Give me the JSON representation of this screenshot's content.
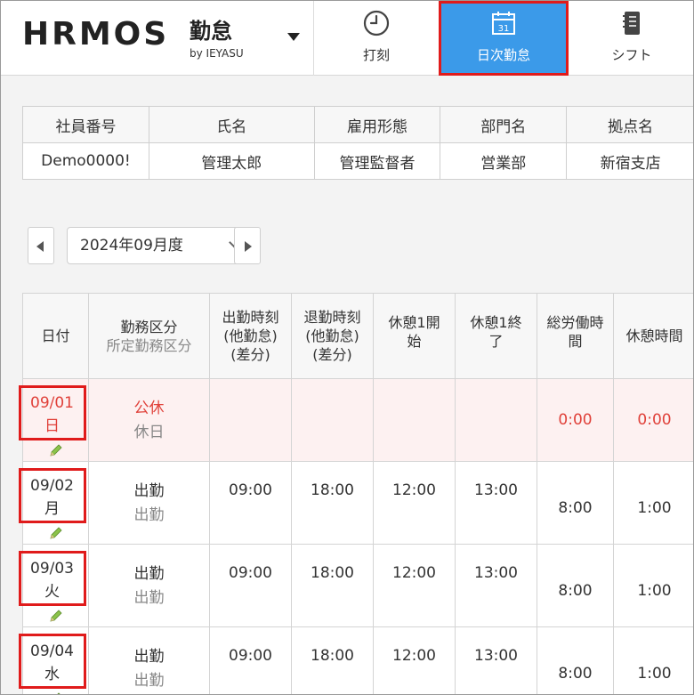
{
  "header": {
    "logo_text": "HRMOS",
    "product": "勤怠",
    "sub": "by IEYASU",
    "nav": [
      {
        "label": "打刻",
        "icon": "clock-icon"
      },
      {
        "label": "日次勤怠",
        "icon": "calendar-icon",
        "badge": "31",
        "active": true
      },
      {
        "label": "シフト",
        "icon": "notebook-icon"
      }
    ],
    "accent_color": "#3b9ae9",
    "highlight_color": "#e01b1b"
  },
  "employee": {
    "headers": [
      "社員番号",
      "氏名",
      "雇用形態",
      "部門名",
      "拠点名"
    ],
    "values": [
      "Demo0000!",
      "管理太郎",
      "管理監督者",
      "営業部",
      "新宿支店"
    ]
  },
  "period": {
    "selected": "2024年09月度"
  },
  "daily": {
    "headers": {
      "date": "日付",
      "type": "勤務区分",
      "type_sub": "所定勤務区分",
      "clock_in_1": "出勤時刻",
      "clock_in_2": "(他勤怠)",
      "clock_in_3": "(差分)",
      "clock_out_1": "退勤時刻",
      "clock_out_2": "(他勤怠)",
      "clock_out_3": "(差分)",
      "break1_start_1": "休憩1開",
      "break1_start_2": "始",
      "break1_end_1": "休憩1終",
      "break1_end_2": "了",
      "total_1": "総労働時",
      "total_2": "間",
      "break_time": "休憩時間"
    },
    "rows": [
      {
        "date": "09/01",
        "weekday": "日",
        "type": "公休",
        "type_sub": "休日",
        "in": "",
        "out": "",
        "b_start": "",
        "b_end": "",
        "total": "0:00",
        "break": "0:00"
      },
      {
        "date": "09/02",
        "weekday": "月",
        "type": "出勤",
        "type_sub": "出勤",
        "in": "09:00",
        "out": "18:00",
        "b_start": "12:00",
        "b_end": "13:00",
        "total": "8:00",
        "break": "1:00"
      },
      {
        "date": "09/03",
        "weekday": "火",
        "type": "出勤",
        "type_sub": "出勤",
        "in": "09:00",
        "out": "18:00",
        "b_start": "12:00",
        "b_end": "13:00",
        "total": "8:00",
        "break": "1:00"
      },
      {
        "date": "09/04",
        "weekday": "水",
        "type": "出勤",
        "type_sub": "出勤",
        "in": "09:00",
        "out": "18:00",
        "b_start": "12:00",
        "b_end": "13:00",
        "total": "8:00",
        "break": "1:00"
      }
    ]
  }
}
